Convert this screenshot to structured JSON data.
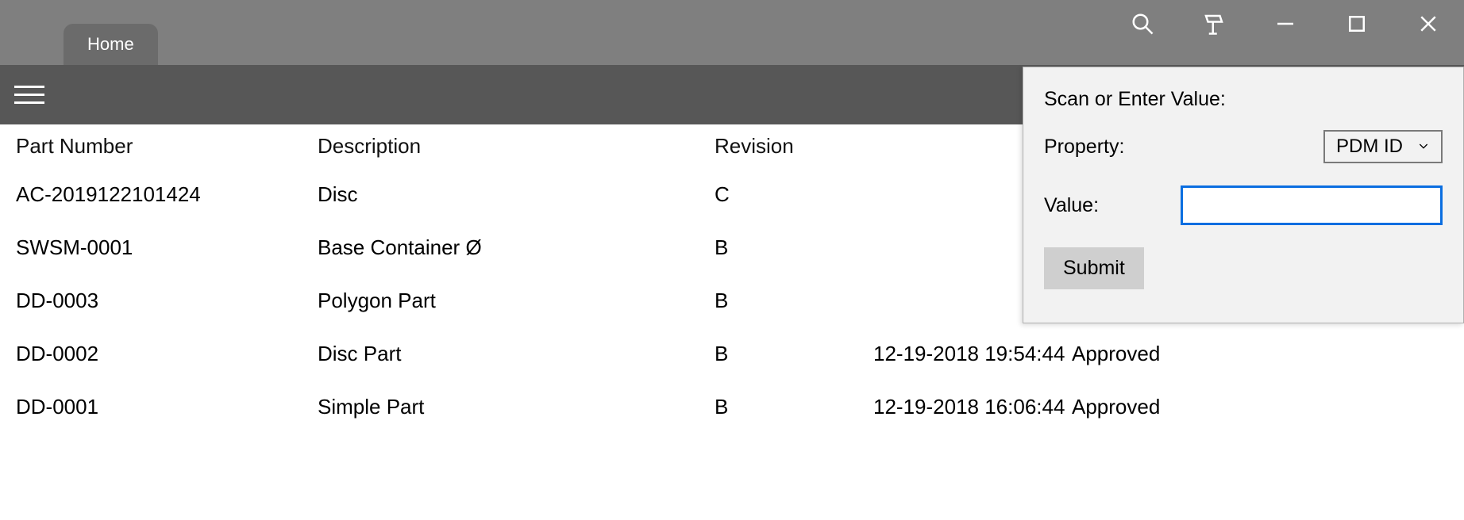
{
  "titlebar": {
    "tab_home": "Home"
  },
  "table": {
    "headers": {
      "part_number": "Part Number",
      "description": "Description",
      "revision": "Revision"
    },
    "rows": [
      {
        "part_number": "AC-2019122101424",
        "description": "Disc",
        "revision": "C",
        "date": "",
        "status": ""
      },
      {
        "part_number": "SWSM-0001",
        "description": "Base Container Ø",
        "revision": "B",
        "date": "",
        "status": ""
      },
      {
        "part_number": "DD-0003",
        "description": "Polygon Part",
        "revision": "B",
        "date": "",
        "status": ""
      },
      {
        "part_number": "DD-0002",
        "description": "Disc Part",
        "revision": "B",
        "date": "12-19-2018 19:54:44",
        "status": "Approved"
      },
      {
        "part_number": "DD-0001",
        "description": "Simple Part",
        "revision": "B",
        "date": "12-19-2018 16:06:44",
        "status": "Approved"
      }
    ]
  },
  "flyout": {
    "title": "Scan or Enter Value:",
    "property_label": "Property:",
    "property_value": "PDM ID",
    "value_label": "Value:",
    "value_input": "",
    "submit": "Submit"
  }
}
